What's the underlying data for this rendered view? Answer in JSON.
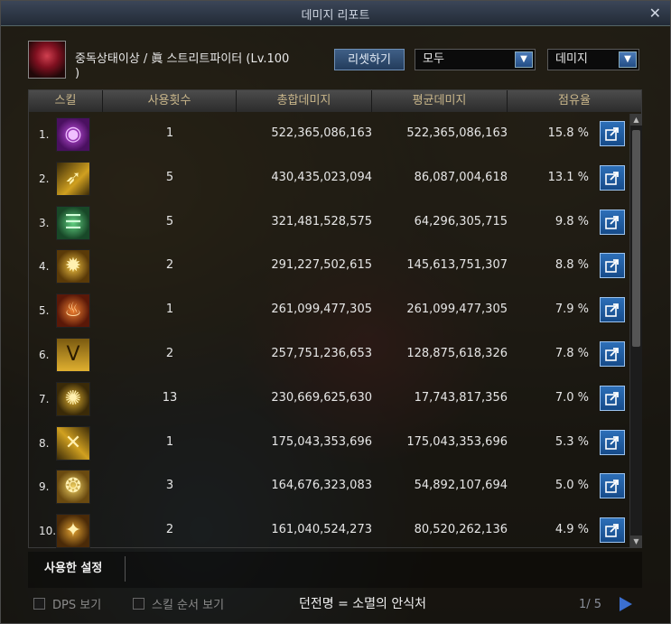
{
  "window": {
    "title": "데미지 리포트"
  },
  "character": {
    "line1": "중독상태이상 / 眞 스트리트파이터 (Lv.100",
    "line2": ")"
  },
  "controls": {
    "reset_label": "리셋하기",
    "filter_value": "모두",
    "type_value": "데미지"
  },
  "table": {
    "headers": [
      "스킬",
      "사용횟수",
      "총합데미지",
      "평균데미지",
      "점유율"
    ],
    "rows": [
      {
        "num": "1.",
        "icon": "skill-icon-purple-orb",
        "uses": "1",
        "total": "522,365,086,163",
        "avg": "522,365,086,163",
        "share": "15.8 %"
      },
      {
        "num": "2.",
        "icon": "skill-icon-golden-streak",
        "uses": "5",
        "total": "430,435,023,094",
        "avg": "86,087,004,618",
        "share": "13.1 %"
      },
      {
        "num": "3.",
        "icon": "skill-icon-green-totem",
        "uses": "5",
        "total": "321,481,528,575",
        "avg": "64,296,305,715",
        "share": "9.8 %"
      },
      {
        "num": "4.",
        "icon": "skill-icon-golden-sun",
        "uses": "2",
        "total": "291,227,502,615",
        "avg": "145,613,751,307",
        "share": "8.8 %"
      },
      {
        "num": "5.",
        "icon": "skill-icon-fire-dragon",
        "uses": "1",
        "total": "261,099,477,305",
        "avg": "261,099,477,305",
        "share": "7.9 %"
      },
      {
        "num": "6.",
        "icon": "skill-icon-golden-v",
        "uses": "2",
        "total": "257,751,236,653",
        "avg": "128,875,618,326",
        "share": "7.8 %"
      },
      {
        "num": "7.",
        "icon": "skill-icon-gold-bomb",
        "uses": "13",
        "total": "230,669,625,630",
        "avg": "17,743,817,356",
        "share": "7.0 %"
      },
      {
        "num": "8.",
        "icon": "skill-icon-gold-claw",
        "uses": "1",
        "total": "175,043,353,696",
        "avg": "175,043,353,696",
        "share": "5.3 %"
      },
      {
        "num": "9.",
        "icon": "skill-icon-gold-spiral",
        "uses": "3",
        "total": "164,676,323,083",
        "avg": "54,892,107,694",
        "share": "5.0 %"
      },
      {
        "num": "10.",
        "icon": "skill-icon-gold-burst",
        "uses": "2",
        "total": "161,040,524,273",
        "avg": "80,520,262,136",
        "share": "4.9 %"
      }
    ]
  },
  "bottom": {
    "used_tab": "사용한 설정",
    "dps_label": "DPS 보기",
    "skill_order_label": "스킬 순서 보기",
    "dungeon": "던전명 = 소멸의 안식처",
    "pager": "1/ 5"
  }
}
